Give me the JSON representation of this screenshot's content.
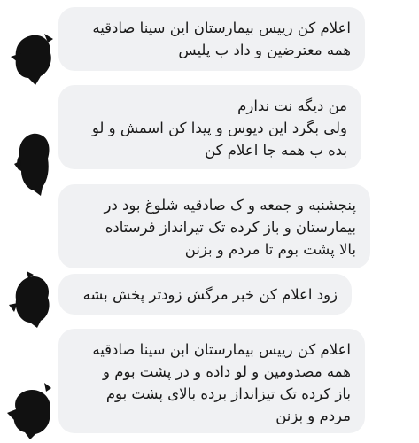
{
  "messages": [
    {
      "text": "اعلام کن رییس بیمارستان این سینا صادقیه\nهمه معترضین و داد ب پلیس"
    },
    {
      "text": "من دیگه نت ندارم\nولی بگرد این دیوس و پیدا کن اسمش و لو\nبده ب همه جا اعلام کن"
    },
    {
      "text": "پنجشنبه و جمعه و ک صادقیه شلوغ بود در\nبیمارستان و باز کرده تک تیرانداز فرستاده\nبالا پشت بوم تا مردم و بزنن"
    },
    {
      "text": "زود اعلام کن خبر مرگش زودتر پخش بشه"
    },
    {
      "text": "اعلام کن رییس بیمارستان ابن سینا صادقیه\nهمه مصدومین و لو داده و در پشت بوم و\nباز کرده تک تیزانداز برده بالای پشت بوم\nمردم و بزنن"
    }
  ],
  "colors": {
    "bubble": "#f0f1f3",
    "text": "#1a1a1a",
    "avatar_redaction": "#111111"
  },
  "icons": {
    "avatar": "redacted-avatar-icon"
  }
}
